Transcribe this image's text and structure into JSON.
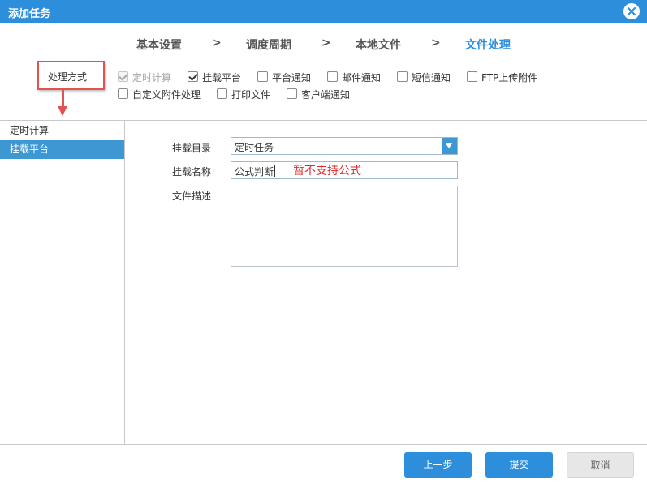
{
  "window": {
    "title": "添加任务",
    "close_icon": "close-icon"
  },
  "steps": [
    {
      "label": "基本设置",
      "active": false
    },
    {
      "label": "调度周期",
      "active": false
    },
    {
      "label": "本地文件",
      "active": false
    },
    {
      "label": "文件处理",
      "active": true
    }
  ],
  "step_separator": ">",
  "mode_label": "处理方式",
  "options": [
    {
      "label": "定时计算",
      "checked": true,
      "disabled": true
    },
    {
      "label": "挂载平台",
      "checked": true,
      "disabled": false
    },
    {
      "label": "平台通知",
      "checked": false,
      "disabled": false
    },
    {
      "label": "邮件通知",
      "checked": false,
      "disabled": false
    },
    {
      "label": "短信通知",
      "checked": false,
      "disabled": false
    },
    {
      "label": "FTP上传附件",
      "checked": false,
      "disabled": false
    },
    {
      "label": "自定义附件处理",
      "checked": false,
      "disabled": false
    },
    {
      "label": "打印文件",
      "checked": false,
      "disabled": false
    },
    {
      "label": "客户端通知",
      "checked": false,
      "disabled": false
    }
  ],
  "sidebar": {
    "items": [
      {
        "label": "定时计算",
        "selected": false
      },
      {
        "label": "挂载平台",
        "selected": true
      }
    ]
  },
  "form": {
    "dir_label": "挂载目录",
    "dir_value": "定时任务",
    "name_label": "挂载名称",
    "name_value": "公式判断",
    "desc_label": "文件描述",
    "desc_value": ""
  },
  "annotation": "暂不支持公式",
  "buttons": {
    "prev": "上一步",
    "submit": "提交",
    "cancel": "取消"
  },
  "colors": {
    "accent": "#2d8fdc",
    "highlight": "#e05350",
    "selected_row": "#3d97d3"
  }
}
